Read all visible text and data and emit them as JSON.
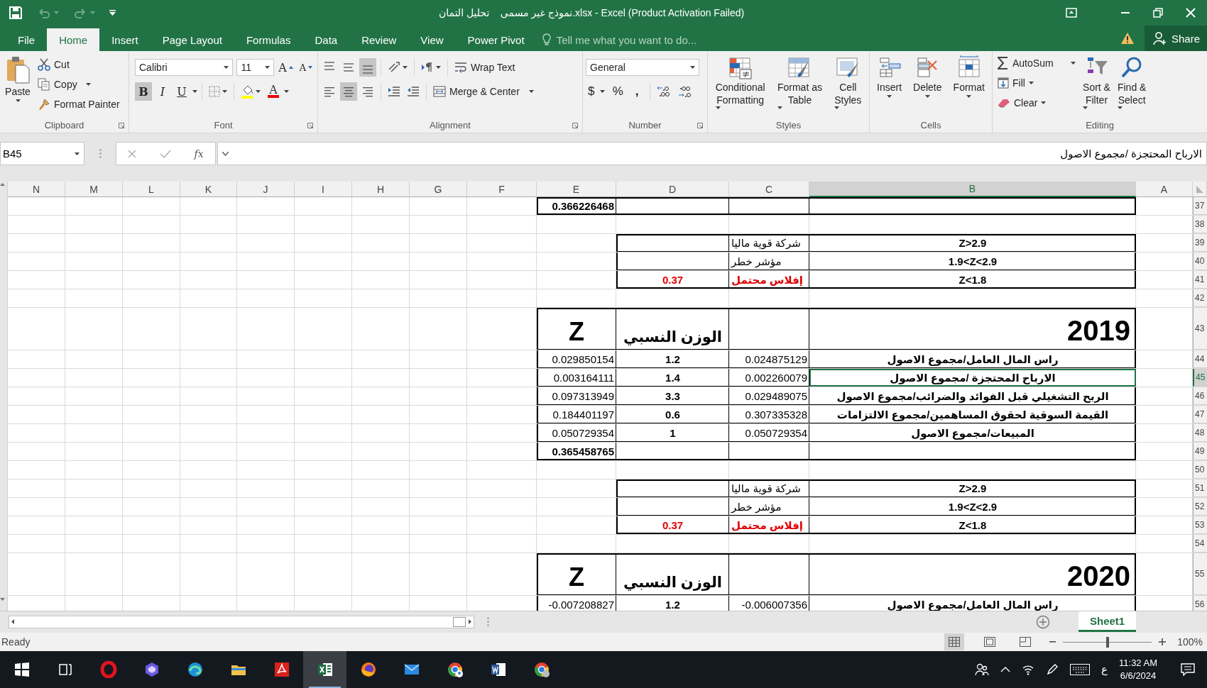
{
  "title_bar": {
    "title": "نموذج غير مسمى    تحليل التمان.xlsx - Excel (Product Activation Failed)"
  },
  "menu_tabs": [
    {
      "label": "File",
      "selected": false
    },
    {
      "label": "Home",
      "selected": true
    },
    {
      "label": "Insert",
      "selected": false
    },
    {
      "label": "Page Layout",
      "selected": false
    },
    {
      "label": "Formulas",
      "selected": false
    },
    {
      "label": "Data",
      "selected": false
    },
    {
      "label": "Review",
      "selected": false
    },
    {
      "label": "View",
      "selected": false
    },
    {
      "label": "Power Pivot",
      "selected": false
    }
  ],
  "tell_me": {
    "placeholder": "Tell me what you want to do..."
  },
  "share": "Share",
  "ribbon": {
    "clipboard": {
      "label": "Clipboard",
      "paste": "Paste",
      "cut": "Cut",
      "copy": "Copy",
      "format_painter": "Format Painter"
    },
    "font": {
      "label": "Font",
      "font_name": "Calibri",
      "font_size": "11",
      "grow": "A",
      "shrink": "A",
      "bold": "B",
      "bold_on": true,
      "italic": "I",
      "underline": "U",
      "font_color": "A"
    },
    "alignment": {
      "label": "Alignment",
      "bottom_align_on": true,
      "center_on": true,
      "wrap_text": "Wrap Text",
      "merge_center": "Merge & Center"
    },
    "number": {
      "label": "Number",
      "format": "General",
      "currency": "$",
      "percent": "%",
      "comma": ","
    },
    "styles": {
      "label": "Styles",
      "buttons": [
        [
          "Conditional",
          "Formatting"
        ],
        [
          "Format as",
          "Table"
        ],
        [
          "Cell",
          "Styles"
        ]
      ]
    },
    "cells": {
      "label": "Cells",
      "buttons": [
        "Insert",
        "Delete",
        "Format"
      ]
    },
    "editing": {
      "label": "Editing",
      "autosum": "AutoSum",
      "fill": "Fill",
      "clear": "Clear",
      "sort_filter": [
        "Sort &",
        "Filter"
      ],
      "find_select": [
        "Find &",
        "Select"
      ]
    }
  },
  "formula_bar": {
    "name_box": "B45",
    "function_label": "fx",
    "formula": "الارباح المحتجزة /مجموع الاصول"
  },
  "sheet": {
    "columns": [
      {
        "label": "N",
        "selected": false
      },
      {
        "label": "M",
        "selected": false
      },
      {
        "label": "L",
        "selected": false
      },
      {
        "label": "K",
        "selected": false
      },
      {
        "label": "J",
        "selected": false
      },
      {
        "label": "I",
        "selected": false
      },
      {
        "label": "H",
        "selected": false
      },
      {
        "label": "G",
        "selected": false
      },
      {
        "label": "F",
        "selected": false
      },
      {
        "label": "E",
        "selected": false
      },
      {
        "label": "D",
        "selected": false
      },
      {
        "label": "C",
        "selected": false
      },
      {
        "label": "B",
        "selected": true
      },
      {
        "label": "A",
        "selected": false
      }
    ],
    "rows": [
      {
        "number": "37",
        "selected": false,
        "kind": "total",
        "E": "0.366226468"
      },
      {
        "number": "38",
        "selected": false,
        "kind": "blank"
      },
      {
        "number": "39",
        "selected": false,
        "kind": "scale",
        "alert": false,
        "C": "شركة قوية ماليا",
        "B": "Z>2.9"
      },
      {
        "number": "40",
        "selected": false,
        "kind": "scale",
        "alert": false,
        "C": "مؤشر خطر",
        "B": "1.9<Z<2.9"
      },
      {
        "number": "41",
        "selected": false,
        "kind": "scale",
        "alert": true,
        "D": "0.37",
        "C": "إفلاس محتمل",
        "B": "Z<1.8"
      },
      {
        "number": "42",
        "selected": false,
        "kind": "blank"
      },
      {
        "number": "43",
        "selected": false,
        "kind": "header",
        "E": "Z",
        "D": "الوزن النسبي",
        "B": "2019"
      },
      {
        "number": "44",
        "selected": false,
        "kind": "data",
        "E": "0.029850154",
        "D": "1.2",
        "C": "0.024875129",
        "B": "راس المال العامل/مجموع الاصول"
      },
      {
        "number": "45",
        "selected": true,
        "kind": "data",
        "E": "0.003164111",
        "D": "1.4",
        "C": "0.002260079",
        "B": "الارباح المحتجزة /مجموع الاصول"
      },
      {
        "number": "46",
        "selected": false,
        "kind": "data",
        "E": "0.097313949",
        "D": "3.3",
        "C": "0.029489075",
        "B": "الربح التشغيلي قبل الفوائد والضرائب/مجموع الاصول"
      },
      {
        "number": "47",
        "selected": false,
        "kind": "data",
        "E": "0.184401197",
        "D": "0.6",
        "C": "0.307335328",
        "B": "القيمة السوقية لحقوق المساهمين/مجموع الالتزامات"
      },
      {
        "number": "48",
        "selected": false,
        "kind": "data",
        "E": "0.050729354",
        "D": "1",
        "C": "0.050729354",
        "B": "المبيعات/مجموع الاصول"
      },
      {
        "number": "49",
        "selected": false,
        "kind": "total",
        "E": "0.365458765"
      },
      {
        "number": "50",
        "selected": false,
        "kind": "blank"
      },
      {
        "number": "51",
        "selected": false,
        "kind": "scale",
        "alert": false,
        "C": "شركة قوية ماليا",
        "B": "Z>2.9"
      },
      {
        "number": "52",
        "selected": false,
        "kind": "scale",
        "alert": false,
        "C": "مؤشر خطر",
        "B": "1.9<Z<2.9"
      },
      {
        "number": "53",
        "selected": false,
        "kind": "scale",
        "alert": true,
        "D": "0.37",
        "C": "إفلاس محتمل",
        "B": "Z<1.8"
      },
      {
        "number": "54",
        "selected": false,
        "kind": "blank"
      },
      {
        "number": "55",
        "selected": false,
        "kind": "header",
        "E": "Z",
        "D": "الوزن النسبي",
        "B": "2020"
      },
      {
        "number": "56",
        "selected": false,
        "kind": "data",
        "E": "-0.007208827",
        "D": "1.2",
        "C": "-0.006007356",
        "B": "راس المال العامل/مجموع الاصول"
      }
    ]
  },
  "sheet_tabs": [
    {
      "label": "Sheet1",
      "selected": true
    }
  ],
  "status_bar": {
    "status": "Ready",
    "zoom": {
      "level": 0.5,
      "reading": "100%"
    }
  },
  "taskbar": {
    "input_language": "ع",
    "time": "11:32 AM",
    "date": "6/6/2024"
  }
}
